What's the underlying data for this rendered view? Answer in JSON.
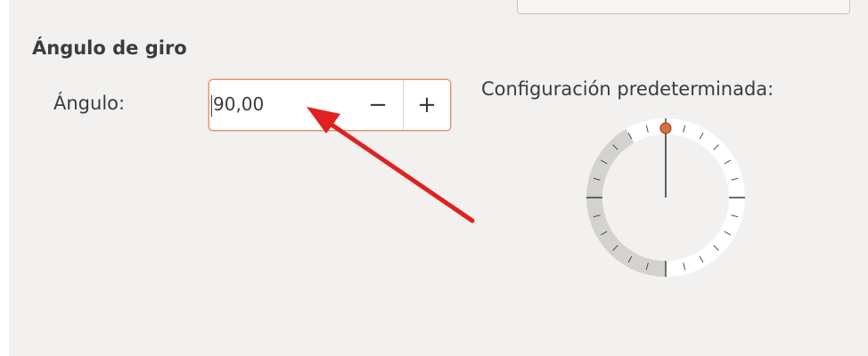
{
  "section": {
    "title": "Ángulo de giro"
  },
  "angle": {
    "label": "Ángulo:",
    "value": "90,00",
    "decrement_symbol": "−",
    "increment_symbol": "+"
  },
  "default_settings": {
    "label": "Configuración predeterminada:"
  },
  "dial": {
    "current_angle_degrees": 90,
    "accent_color": "#e06d3e"
  },
  "annotation": {
    "arrow_color": "#e0211f"
  }
}
